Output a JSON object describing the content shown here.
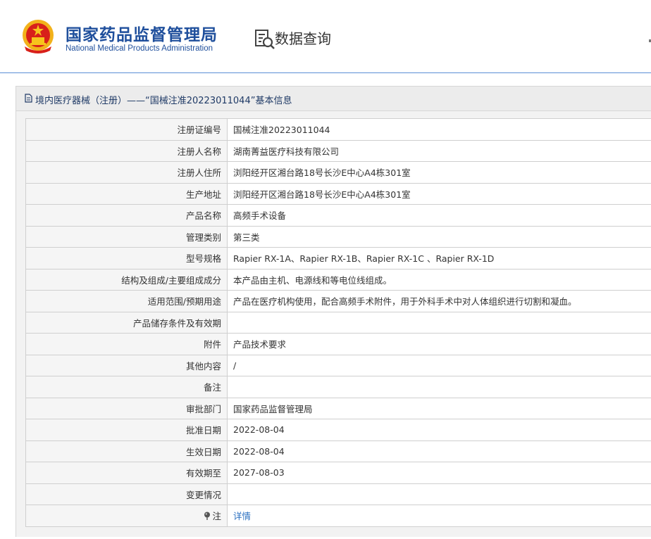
{
  "header": {
    "org_name_cn": "国家药品监督管理局",
    "org_name_en": "National Medical Products Administration",
    "query_label": "数据查询",
    "emblem_icon": "national-emblem-icon",
    "query_icon": "data-query-icon",
    "brand_color": "#1f4f9c"
  },
  "panel": {
    "title": "境内医疗器械（注册）——“国械注准20223011044”基本信息",
    "title_icon": "document-icon"
  },
  "rows": [
    {
      "label": "注册证编号",
      "value": "国械注准20223011044"
    },
    {
      "label": "注册人名称",
      "value": "湖南菁益医疗科技有限公司"
    },
    {
      "label": "注册人住所",
      "value": "浏阳经开区湘台路18号长沙E中心A4栋301室"
    },
    {
      "label": "生产地址",
      "value": "浏阳经开区湘台路18号长沙E中心A4栋301室"
    },
    {
      "label": "产品名称",
      "value": "高频手术设备"
    },
    {
      "label": "管理类别",
      "value": "第三类"
    },
    {
      "label": "型号规格",
      "value": "Rapier RX-1A、Rapier RX-1B、Rapier RX-1C 、Rapier RX-1D"
    },
    {
      "label": "结构及组成/主要组成成分",
      "value": "本产品由主机、电源线和等电位线组成。"
    },
    {
      "label": "适用范围/预期用途",
      "value": "产品在医疗机构使用，配合高频手术附件，用于外科手术中对人体组织进行切割和凝血。"
    },
    {
      "label": "产品储存条件及有效期",
      "value": ""
    },
    {
      "label": "附件",
      "value": "产品技术要求"
    },
    {
      "label": "其他内容",
      "value": "/"
    },
    {
      "label": "备注",
      "value": ""
    },
    {
      "label": "审批部门",
      "value": "国家药品监督管理局"
    },
    {
      "label": "批准日期",
      "value": "2022-08-04"
    },
    {
      "label": "生效日期",
      "value": "2022-08-04"
    },
    {
      "label": "有效期至",
      "value": "2027-08-03"
    },
    {
      "label": "变更情况",
      "value": ""
    },
    {
      "label": "注",
      "value": "详情",
      "link": true,
      "label_icon": "pin-icon"
    }
  ],
  "link_color": "#2a6fc0"
}
